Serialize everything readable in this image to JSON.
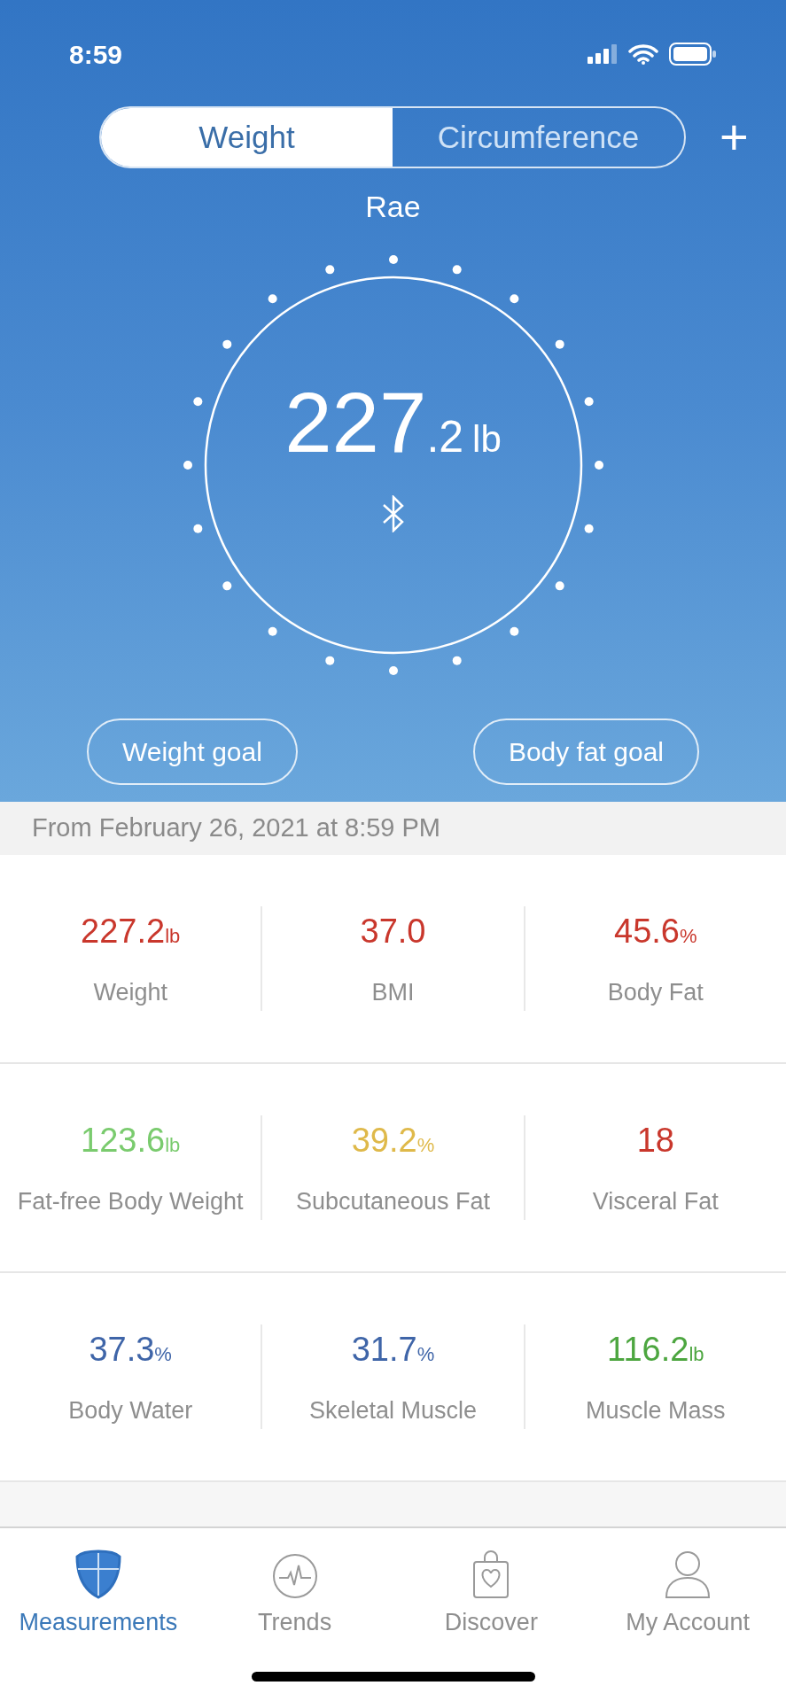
{
  "status_bar": {
    "time": "8:59"
  },
  "segments": [
    {
      "label": "Weight",
      "selected": true
    },
    {
      "label": "Circumference",
      "selected": false
    }
  ],
  "add_button": "+",
  "user": "Rae",
  "reading": {
    "whole": "227",
    "fraction": ".2",
    "unit": "lb"
  },
  "goal_buttons": [
    "Weight goal",
    "Body fat goal"
  ],
  "date_line": "From February 26, 2021 at 8:59 PM",
  "metric_rows": [
    [
      {
        "value": "227.2",
        "unit": "lb",
        "label": "Weight",
        "color": "#c9372c"
      },
      {
        "value": "37.0",
        "label": "BMI",
        "color": "#c9372c"
      },
      {
        "value": "45.6",
        "unit": "%",
        "label": "Body Fat",
        "color": "#c9372c"
      }
    ],
    [
      {
        "value": "123.6",
        "unit": "lb",
        "label": "Fat-free Body Weight",
        "color": "#7acb6e"
      },
      {
        "value": "39.2",
        "unit": "%",
        "label": "Subcutaneous Fat",
        "color": "#dfb94a"
      },
      {
        "value": "18",
        "label": "Visceral Fat",
        "color": "#c9372c"
      }
    ],
    [
      {
        "value": "37.3",
        "unit": "%",
        "label": "Body Water",
        "color": "#3f65a8"
      },
      {
        "value": "31.7",
        "unit": "%",
        "label": "Skeletal Muscle",
        "color": "#3f65a8"
      },
      {
        "value": "116.2",
        "unit": "lb",
        "label": "Muscle Mass",
        "color": "#4da640"
      }
    ]
  ],
  "tab_bar": [
    {
      "label": "Measurements",
      "kind": "shield",
      "selected": true
    },
    {
      "label": "Trends",
      "kind": "pulse",
      "selected": false
    },
    {
      "label": "Discover",
      "kind": "bag",
      "selected": false
    },
    {
      "label": "My Account",
      "kind": "person",
      "selected": false
    }
  ]
}
